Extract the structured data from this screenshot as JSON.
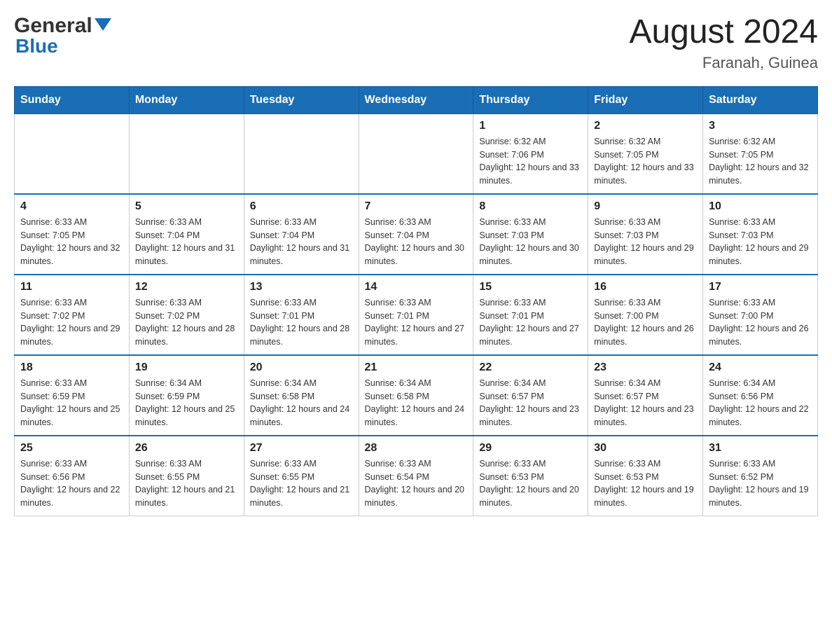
{
  "header": {
    "logo_general": "General",
    "logo_blue": "Blue",
    "month_year": "August 2024",
    "location": "Faranah, Guinea"
  },
  "days_of_week": [
    "Sunday",
    "Monday",
    "Tuesday",
    "Wednesday",
    "Thursday",
    "Friday",
    "Saturday"
  ],
  "weeks": [
    [
      {
        "day": "",
        "sunrise": "",
        "sunset": "",
        "daylight": ""
      },
      {
        "day": "",
        "sunrise": "",
        "sunset": "",
        "daylight": ""
      },
      {
        "day": "",
        "sunrise": "",
        "sunset": "",
        "daylight": ""
      },
      {
        "day": "",
        "sunrise": "",
        "sunset": "",
        "daylight": ""
      },
      {
        "day": "1",
        "sunrise": "Sunrise: 6:32 AM",
        "sunset": "Sunset: 7:06 PM",
        "daylight": "Daylight: 12 hours and 33 minutes."
      },
      {
        "day": "2",
        "sunrise": "Sunrise: 6:32 AM",
        "sunset": "Sunset: 7:05 PM",
        "daylight": "Daylight: 12 hours and 33 minutes."
      },
      {
        "day": "3",
        "sunrise": "Sunrise: 6:32 AM",
        "sunset": "Sunset: 7:05 PM",
        "daylight": "Daylight: 12 hours and 32 minutes."
      }
    ],
    [
      {
        "day": "4",
        "sunrise": "Sunrise: 6:33 AM",
        "sunset": "Sunset: 7:05 PM",
        "daylight": "Daylight: 12 hours and 32 minutes."
      },
      {
        "day": "5",
        "sunrise": "Sunrise: 6:33 AM",
        "sunset": "Sunset: 7:04 PM",
        "daylight": "Daylight: 12 hours and 31 minutes."
      },
      {
        "day": "6",
        "sunrise": "Sunrise: 6:33 AM",
        "sunset": "Sunset: 7:04 PM",
        "daylight": "Daylight: 12 hours and 31 minutes."
      },
      {
        "day": "7",
        "sunrise": "Sunrise: 6:33 AM",
        "sunset": "Sunset: 7:04 PM",
        "daylight": "Daylight: 12 hours and 30 minutes."
      },
      {
        "day": "8",
        "sunrise": "Sunrise: 6:33 AM",
        "sunset": "Sunset: 7:03 PM",
        "daylight": "Daylight: 12 hours and 30 minutes."
      },
      {
        "day": "9",
        "sunrise": "Sunrise: 6:33 AM",
        "sunset": "Sunset: 7:03 PM",
        "daylight": "Daylight: 12 hours and 29 minutes."
      },
      {
        "day": "10",
        "sunrise": "Sunrise: 6:33 AM",
        "sunset": "Sunset: 7:03 PM",
        "daylight": "Daylight: 12 hours and 29 minutes."
      }
    ],
    [
      {
        "day": "11",
        "sunrise": "Sunrise: 6:33 AM",
        "sunset": "Sunset: 7:02 PM",
        "daylight": "Daylight: 12 hours and 29 minutes."
      },
      {
        "day": "12",
        "sunrise": "Sunrise: 6:33 AM",
        "sunset": "Sunset: 7:02 PM",
        "daylight": "Daylight: 12 hours and 28 minutes."
      },
      {
        "day": "13",
        "sunrise": "Sunrise: 6:33 AM",
        "sunset": "Sunset: 7:01 PM",
        "daylight": "Daylight: 12 hours and 28 minutes."
      },
      {
        "day": "14",
        "sunrise": "Sunrise: 6:33 AM",
        "sunset": "Sunset: 7:01 PM",
        "daylight": "Daylight: 12 hours and 27 minutes."
      },
      {
        "day": "15",
        "sunrise": "Sunrise: 6:33 AM",
        "sunset": "Sunset: 7:01 PM",
        "daylight": "Daylight: 12 hours and 27 minutes."
      },
      {
        "day": "16",
        "sunrise": "Sunrise: 6:33 AM",
        "sunset": "Sunset: 7:00 PM",
        "daylight": "Daylight: 12 hours and 26 minutes."
      },
      {
        "day": "17",
        "sunrise": "Sunrise: 6:33 AM",
        "sunset": "Sunset: 7:00 PM",
        "daylight": "Daylight: 12 hours and 26 minutes."
      }
    ],
    [
      {
        "day": "18",
        "sunrise": "Sunrise: 6:33 AM",
        "sunset": "Sunset: 6:59 PM",
        "daylight": "Daylight: 12 hours and 25 minutes."
      },
      {
        "day": "19",
        "sunrise": "Sunrise: 6:34 AM",
        "sunset": "Sunset: 6:59 PM",
        "daylight": "Daylight: 12 hours and 25 minutes."
      },
      {
        "day": "20",
        "sunrise": "Sunrise: 6:34 AM",
        "sunset": "Sunset: 6:58 PM",
        "daylight": "Daylight: 12 hours and 24 minutes."
      },
      {
        "day": "21",
        "sunrise": "Sunrise: 6:34 AM",
        "sunset": "Sunset: 6:58 PM",
        "daylight": "Daylight: 12 hours and 24 minutes."
      },
      {
        "day": "22",
        "sunrise": "Sunrise: 6:34 AM",
        "sunset": "Sunset: 6:57 PM",
        "daylight": "Daylight: 12 hours and 23 minutes."
      },
      {
        "day": "23",
        "sunrise": "Sunrise: 6:34 AM",
        "sunset": "Sunset: 6:57 PM",
        "daylight": "Daylight: 12 hours and 23 minutes."
      },
      {
        "day": "24",
        "sunrise": "Sunrise: 6:34 AM",
        "sunset": "Sunset: 6:56 PM",
        "daylight": "Daylight: 12 hours and 22 minutes."
      }
    ],
    [
      {
        "day": "25",
        "sunrise": "Sunrise: 6:33 AM",
        "sunset": "Sunset: 6:56 PM",
        "daylight": "Daylight: 12 hours and 22 minutes."
      },
      {
        "day": "26",
        "sunrise": "Sunrise: 6:33 AM",
        "sunset": "Sunset: 6:55 PM",
        "daylight": "Daylight: 12 hours and 21 minutes."
      },
      {
        "day": "27",
        "sunrise": "Sunrise: 6:33 AM",
        "sunset": "Sunset: 6:55 PM",
        "daylight": "Daylight: 12 hours and 21 minutes."
      },
      {
        "day": "28",
        "sunrise": "Sunrise: 6:33 AM",
        "sunset": "Sunset: 6:54 PM",
        "daylight": "Daylight: 12 hours and 20 minutes."
      },
      {
        "day": "29",
        "sunrise": "Sunrise: 6:33 AM",
        "sunset": "Sunset: 6:53 PM",
        "daylight": "Daylight: 12 hours and 20 minutes."
      },
      {
        "day": "30",
        "sunrise": "Sunrise: 6:33 AM",
        "sunset": "Sunset: 6:53 PM",
        "daylight": "Daylight: 12 hours and 19 minutes."
      },
      {
        "day": "31",
        "sunrise": "Sunrise: 6:33 AM",
        "sunset": "Sunset: 6:52 PM",
        "daylight": "Daylight: 12 hours and 19 minutes."
      }
    ]
  ]
}
